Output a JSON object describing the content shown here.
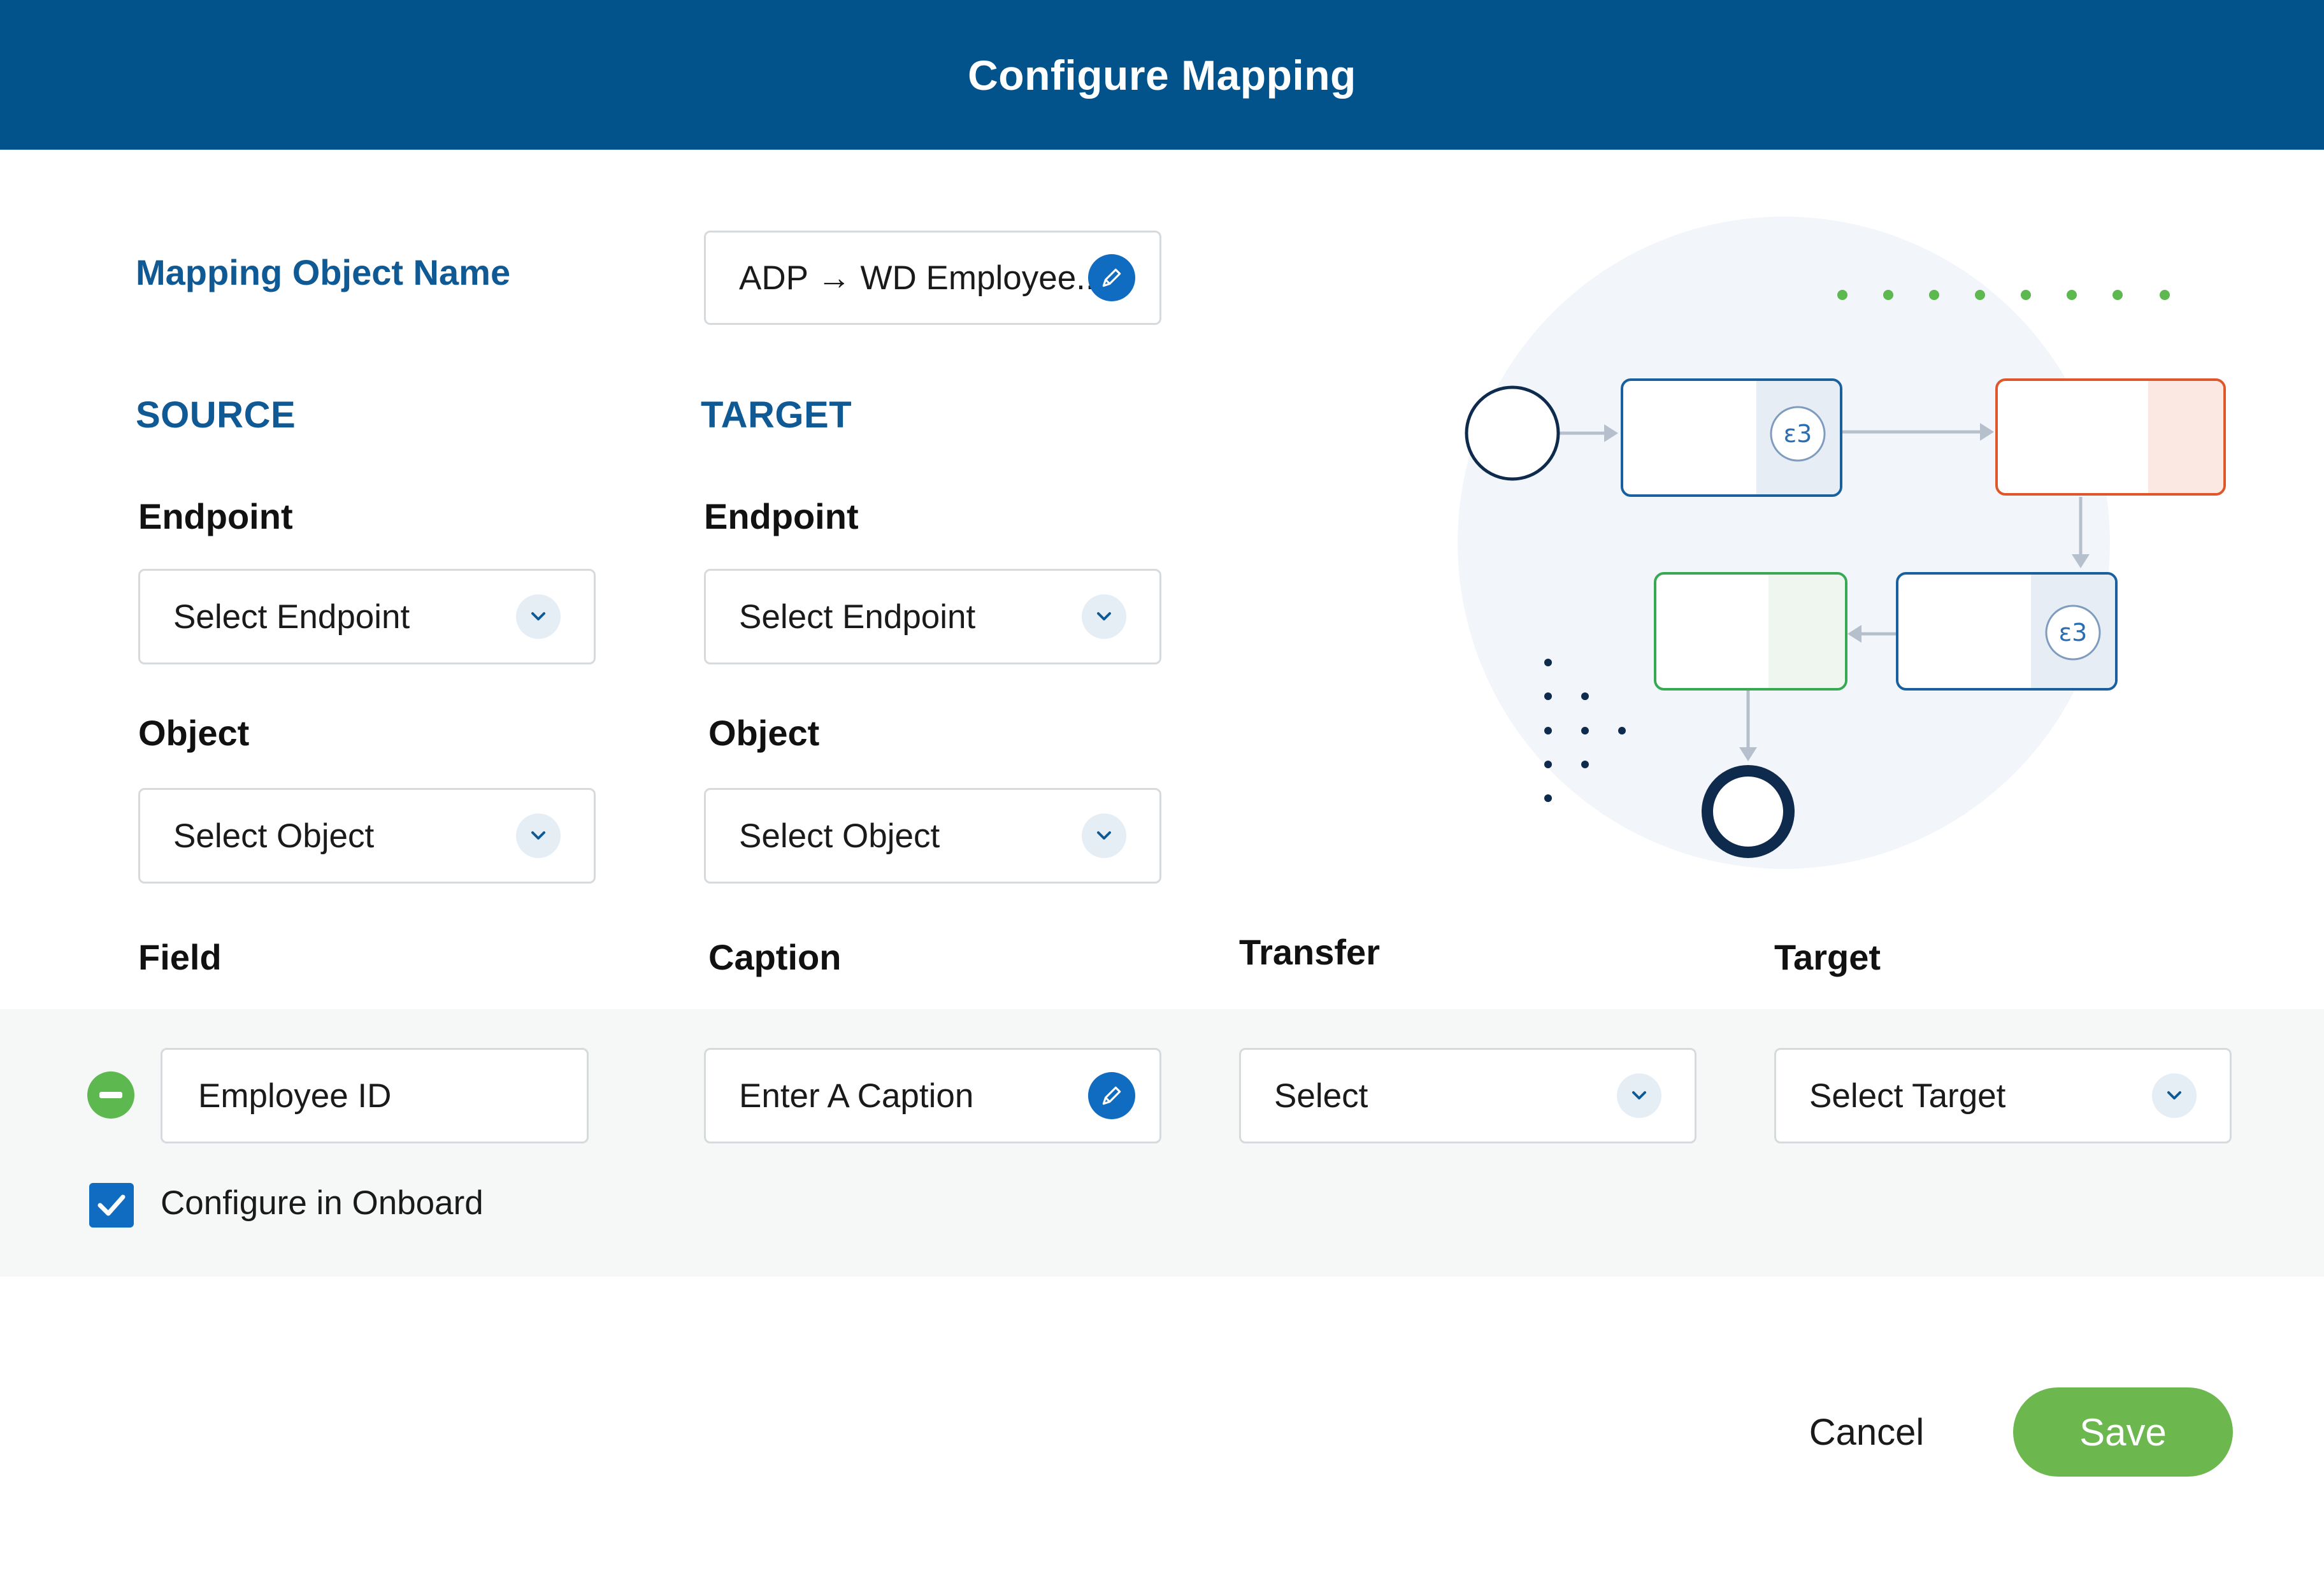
{
  "header": {
    "title": "Configure Mapping"
  },
  "mapping_name": {
    "label": "Mapping Object Name",
    "value": "ADP → WD Employee.."
  },
  "source": {
    "heading": "SOURCE",
    "endpoint_label": "Endpoint",
    "endpoint_value": "Select Endpoint",
    "object_label": "Object",
    "object_value": "Select Object"
  },
  "target": {
    "heading": "TARGET",
    "endpoint_label": "Endpoint",
    "endpoint_value": "Select Endpoint",
    "object_label": "Object",
    "object_value": "Select Object"
  },
  "columns": {
    "field": "Field",
    "caption": "Caption",
    "transfer": "Transfer",
    "target": "Target"
  },
  "row": {
    "field_value": "Employee ID",
    "caption_placeholder": "Enter A Caption",
    "transfer_value": "Select",
    "target_value": "Select Target",
    "checkbox_label": "Configure in Onboard",
    "checkbox_checked": true
  },
  "actions": {
    "cancel": "Cancel",
    "save": "Save"
  },
  "colors": {
    "header": "#02528c",
    "accent_blue": "#0f6cc0",
    "save_green": "#6cb84f",
    "remove_green": "#5cb84f",
    "diagram_orange": "#e0562b",
    "diagram_green": "#39a853"
  },
  "icons": {
    "edit": "pencil-icon",
    "dropdown": "chevron-down-icon",
    "remove": "minus-circle-icon",
    "check": "checkmark-icon",
    "diagram_node": "code-braces-icon"
  }
}
